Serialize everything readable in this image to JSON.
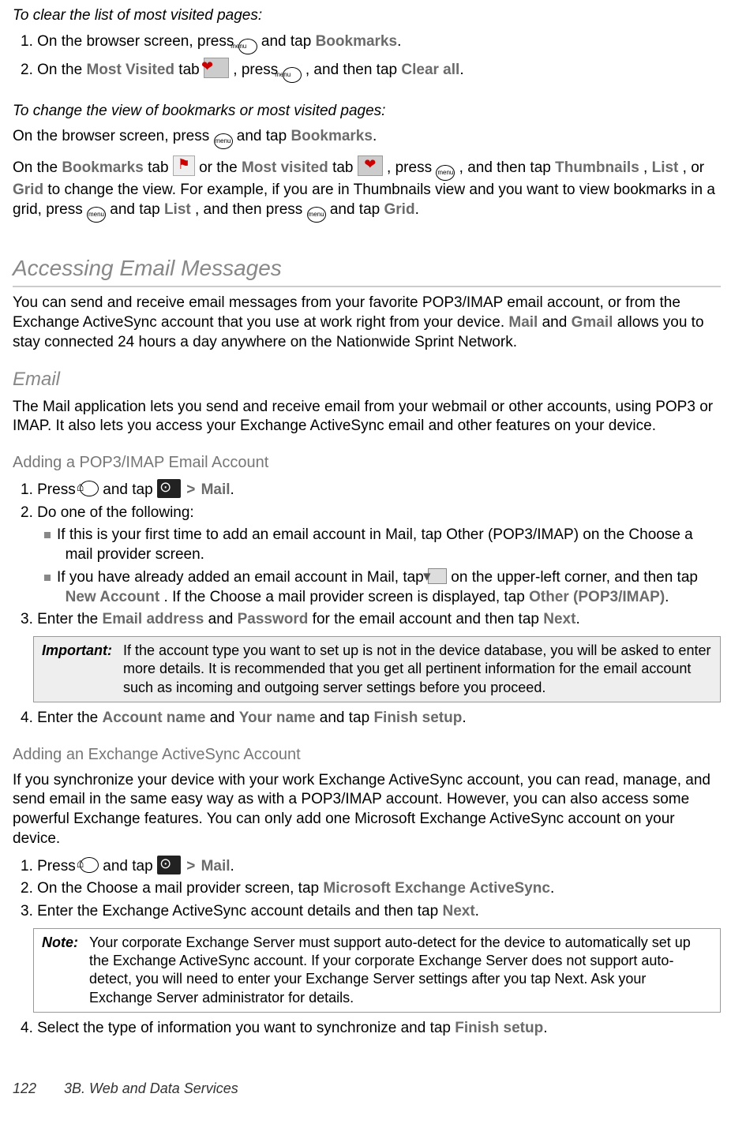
{
  "s1_title": "To clear the list of most visited pages:",
  "s1_step1_a": "1. On the browser screen, press ",
  "s1_step1_b": " and tap ",
  "s1_step1_bold1": "Bookmarks",
  "s1_step1_c": ".",
  "s1_step2_a": "2. On the ",
  "s1_step2_bold1": "Most Visited",
  "s1_step2_b": " tab ",
  "s1_step2_c": ", press ",
  "s1_step2_d": ", and then tap ",
  "s1_step2_bold2": "Clear all",
  "s1_step2_e": ".",
  "s2_title": "To change the view of bookmarks or most visited pages:",
  "s2_p1_a": "On the browser screen, press ",
  "s2_p1_b": " and tap ",
  "s2_p1_bold1": "Bookmarks",
  "s2_p1_c": ".",
  "s2_p2_a": "On the ",
  "s2_p2_bold1": "Bookmarks",
  "s2_p2_b": " tab ",
  "s2_p2_c": " or the ",
  "s2_p2_bold2": "Most visited",
  "s2_p2_d": " tab ",
  "s2_p2_e": ", press ",
  "s2_p2_f": ", and then tap ",
  "s2_p2_bold3": "Thumbnails",
  "s2_p2_g": ", ",
  "s2_p2_bold4": "List",
  "s2_p2_h": ", or ",
  "s2_p2_bold5": "Grid",
  "s2_p2_i": " to change the view. For example, if you are in Thumbnails view and you want to view bookmarks in a grid, press ",
  "s2_p2_j": " and tap ",
  "s2_p2_bold6": "List",
  "s2_p2_k": ", and then press ",
  "s2_p2_l": " and tap ",
  "s2_p2_bold7": "Grid",
  "s2_p2_m": ".",
  "h2_access": "Accessing Email Messages",
  "access_p_a": "You can send and receive email messages from your favorite POP3/IMAP email account, or from the Exchange ActiveSync account that you use at work right from your device. ",
  "access_p_bold1": "Mail",
  "access_p_b": " and ",
  "access_p_bold2": "Gmail",
  "access_p_c": " allows you to stay connected 24 hours a day anywhere on the Nationwide Sprint Network.",
  "h3_email": "Email",
  "email_p": "The Mail application lets you send and receive email from your webmail or other accounts, using POP3 or IMAP. It also lets you access your Exchange ActiveSync email and other features on your device.",
  "h4_pop3": "Adding a POP3/IMAP Email Account",
  "pop3_s1_a": "1. Press ",
  "pop3_s1_b": " and tap ",
  "pop3_s1_gt": " > ",
  "pop3_s1_bold": "Mail",
  "pop3_s1_c": ".",
  "pop3_s2": "2. Do one of the following:",
  "pop3_b1": "If this is your first time to add an email account in Mail, tap Other (POP3/IMAP) on the Choose a mail provider screen.",
  "pop3_b2_a": "If you have already added an email account in Mail, tap ",
  "pop3_b2_b": " on the upper-left corner, and then tap ",
  "pop3_b2_bold1": "New Account",
  "pop3_b2_c": ". If the Choose a mail provider screen is displayed, tap ",
  "pop3_b2_bold2": "Other (POP3/IMAP)",
  "pop3_b2_d": ".",
  "pop3_s3_a": "3. Enter the ",
  "pop3_s3_bold1": "Email address",
  "pop3_s3_b": " and ",
  "pop3_s3_bold2": "Password",
  "pop3_s3_c": " for the email account and then tap ",
  "pop3_s3_bold3": "Next",
  "pop3_s3_d": ".",
  "important_label": "Important:",
  "important_text": "If the account type you want to set up is not in the device database, you will be asked to enter more details. It is recommended that you get all pertinent information for the email account such as incoming and outgoing server settings before you proceed.",
  "pop3_s4_a": "4. Enter the ",
  "pop3_s4_bold1": "Account name",
  "pop3_s4_b": " and ",
  "pop3_s4_bold2": "Your name",
  "pop3_s4_c": " and tap ",
  "pop3_s4_bold3": "Finish setup",
  "pop3_s4_d": ".",
  "h4_ex": "Adding an Exchange ActiveSync Account",
  "ex_p": "If you synchronize your device with your work Exchange ActiveSync account, you can read, manage, and send email in the same easy way as with a POP3/IMAP account. However, you can also access some powerful Exchange features. You can only add one Microsoft Exchange ActiveSync account on your device.",
  "ex_s1_a": "1. Press ",
  "ex_s1_b": " and tap ",
  "ex_s1_gt": " > ",
  "ex_s1_bold": "Mail",
  "ex_s1_c": ".",
  "ex_s2_a": "2. On the Choose a mail provider screen, tap ",
  "ex_s2_bold": "Microsoft Exchange ActiveSync",
  "ex_s2_b": ".",
  "ex_s3_a": "3. Enter the Exchange ActiveSync account details and then tap ",
  "ex_s3_bold": "Next",
  "ex_s3_b": ".",
  "note_label": "Note:",
  "note_text": "Your corporate Exchange Server must support auto-detect for the device to automatically set up the Exchange ActiveSync account. If your corporate Exchange Server does not support auto-detect, you will need to enter your Exchange Server settings after you tap Next. Ask your Exchange Server administrator for details.",
  "ex_s4_a": "4. Select the type of information you want to synchronize and tap ",
  "ex_s4_bold": "Finish setup",
  "ex_s4_b": ".",
  "footer_page": "122",
  "footer_text": "3B. Web and Data Services",
  "menu_text": "menu"
}
